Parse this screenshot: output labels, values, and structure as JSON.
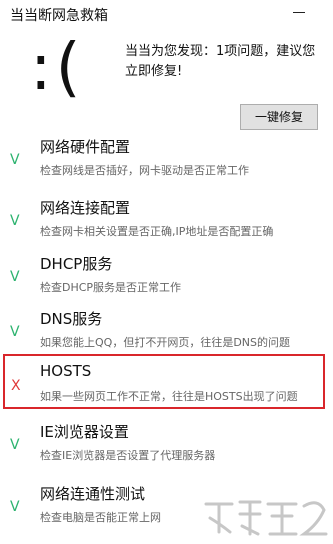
{
  "window": {
    "title": "当当断网急救箱"
  },
  "diagnosis": {
    "face": ":(",
    "message": "当当为您发现：1项问题，建议您立即修复!",
    "fix_button": "一键修复"
  },
  "items": [
    {
      "status": "V",
      "title": "网络硬件配置",
      "desc": "检查网线是否插好，网卡驱动是否正常工作"
    },
    {
      "status": "V",
      "title": "网络连接配置",
      "desc": "检查网卡相关设置是否正确,IP地址是否配置正确"
    },
    {
      "status": "V",
      "title": "DHCP服务",
      "desc": "检查DHCP服务是否正常工作"
    },
    {
      "status": "V",
      "title": "DNS服务",
      "desc": "如果您能上QQ，但打不开网页，往往是DNS的问题"
    },
    {
      "status": "X",
      "title": "HOSTS",
      "desc": "如果一些网页工作不正常，往往是HOSTS出现了问题"
    },
    {
      "status": "V",
      "title": "IE浏览器设置",
      "desc": "检查IE浏览器是否设置了代理服务器"
    },
    {
      "status": "V",
      "title": "网络连通性测试",
      "desc": "检查电脑是否能正常上网"
    }
  ],
  "colors": {
    "ok": "#2db36f",
    "fail": "#e03a3a",
    "highlight": "#d9262b"
  },
  "icons": {
    "minimize": "minimize-icon",
    "watermark": "site-watermark-logo"
  }
}
